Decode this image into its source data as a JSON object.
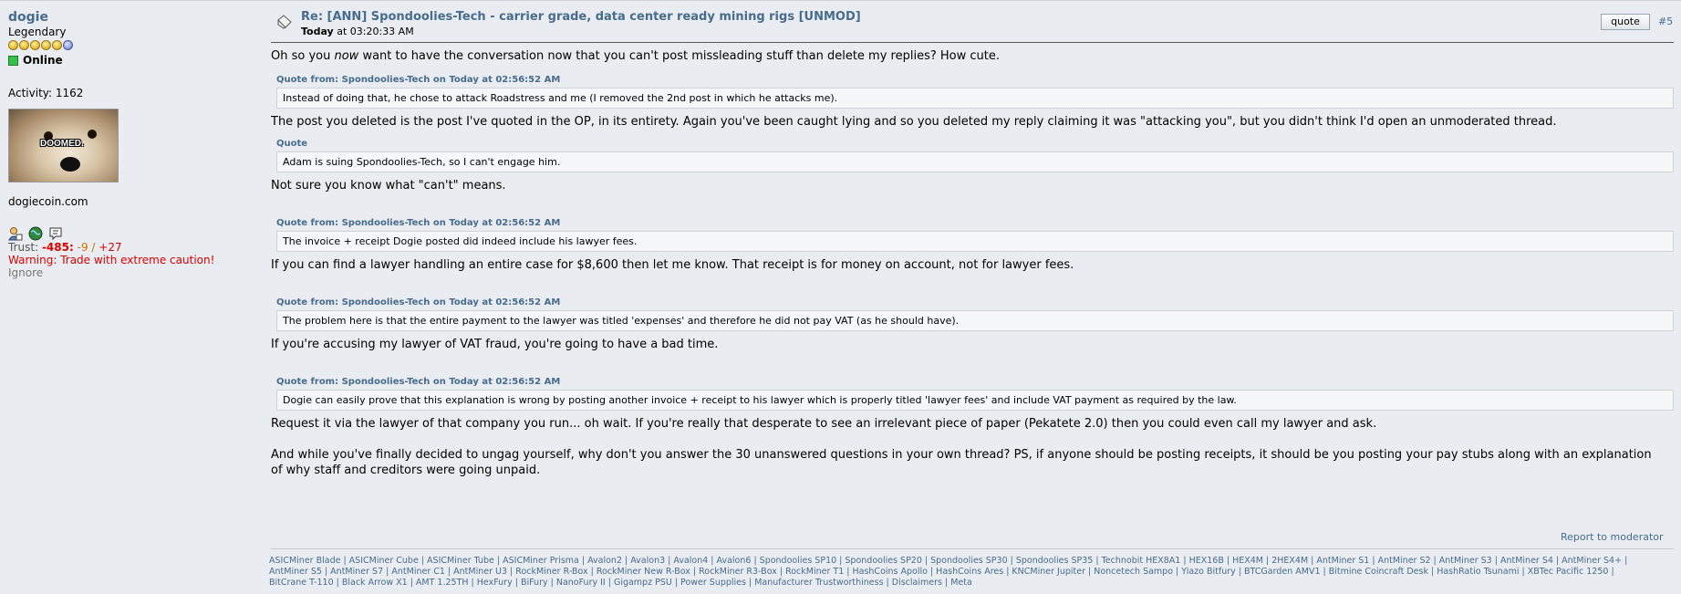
{
  "poster": {
    "username": "dogie",
    "rank": "Legendary",
    "status": "Online",
    "activity": "Activity: 1162",
    "avatar_text": "DOOMED.",
    "website": "dogiecoin.com",
    "trust_label": "Trust:",
    "trust_neg": "-485",
    "trust_neg2": "-9",
    "trust_sep": "/",
    "trust_pos": "+27",
    "warning": "Warning: Trade with extreme caution!",
    "ignore": "Ignore"
  },
  "post": {
    "title": "Re: [ANN] Spondoolies-Tech - carrier grade, data center ready mining rigs [UNMOD]",
    "date_day": "Today",
    "date_time": " at 03:20:33 AM",
    "quote_button": "quote",
    "number": "#5",
    "p1_a": "Oh so you ",
    "p1_em": "now",
    "p1_b": " want to have the conversation now that you can't post missleading stuff than delete my replies? How cute.",
    "q1_head": "Quote from: Spondoolies-Tech on Today at 02:56:52 AM",
    "q1_text": "Instead of doing that, he chose to attack Roadstress and me (I removed the 2nd post in which he attacks me).",
    "p2": "The post you deleted is the post I've quoted in the OP, in its entirety. Again you've been caught lying and so you deleted my reply claiming it was \"attacking you\", but you didn't think I'd open an unmoderated thread.",
    "q2_head": "Quote",
    "q2_text": "Adam is suing Spondoolies-Tech, so I can't engage him.",
    "p3": "Not sure you know what \"can't\" means.",
    "q3_head": "Quote from: Spondoolies-Tech on Today at 02:56:52 AM",
    "q3_text": "The invoice + receipt Dogie posted did indeed include his lawyer fees.",
    "p4": "If you can find a lawyer handling an entire case for $8,600 then let me know. That receipt is for money on account, not for lawyer fees.",
    "q4_head": "Quote from: Spondoolies-Tech on Today at 02:56:52 AM",
    "q4_text": "The problem here is that the entire payment to the lawyer was titled 'expenses' and therefore he did not pay VAT (as he should have).",
    "p5": "If you're accusing my lawyer of VAT fraud, you're going to have a bad time.",
    "q5_head": "Quote from: Spondoolies-Tech on Today at 02:56:52 AM",
    "q5_text": "Dogie can easily prove that this explanation is wrong by posting another invoice + receipt to his lawyer which is properly titled 'lawyer fees' and include VAT payment as required by the law.",
    "p6": "Request it via the lawyer of that company you run... oh wait. If you're really that desperate to see an irrelevant piece of paper (Pekatete 2.0) then you could even call my lawyer and ask.",
    "p7": "And while you've finally decided to ungag yourself, why don't you answer the 30 unanswered questions in your own thread? PS, if anyone should be posting receipts, it should be you posting your pay stubs along with an explanation of why staff and creditors were going unpaid.",
    "report": "Report to moderator"
  },
  "signature": {
    "line1": "ASICMiner Blade | ASICMiner Cube | ASICMiner Tube | ASICMiner Prisma | Avalon2 | Avalon3 | Avalon4 | Avalon6 | Spondoolies SP10 | Spondoolies SP20 | Spondoolies SP30 | Spondoolies SP35 | Technobit HEX8A1 | HEX16B | HEX4M | 2HEX4M | AntMiner S1 | AntMiner S2 | AntMiner S3 | AntMiner S4 | AntMiner S4+ |",
    "line2": "AntMiner S5 | AntMiner S7 | AntMiner C1 | AntMiner U3 | RockMiner R-Box | RockMiner New R-Box | RockMiner R3-Box | RockMiner T1 | HashCoins Apollo | HashCoins Ares | KNCMiner Jupiter | Noncetech Sampo | Yiazo Bitfury | BTCGarden AMV1 | Bitmine Coincraft Desk | HashRatio Tsunami | XBTec Pacific 1250 |",
    "line3": "BitCrane T-110 | Black Arrow X1 | AMT 1.25TH | HexFury | BiFury | NanoFury II | Gigampz PSU | Power Supplies | Manufacturer Trustworthiness | Disclaimers | Meta"
  },
  "colors": {
    "link": "#476c8e",
    "background": "#e9ecf0",
    "warning": "#dd0000"
  }
}
